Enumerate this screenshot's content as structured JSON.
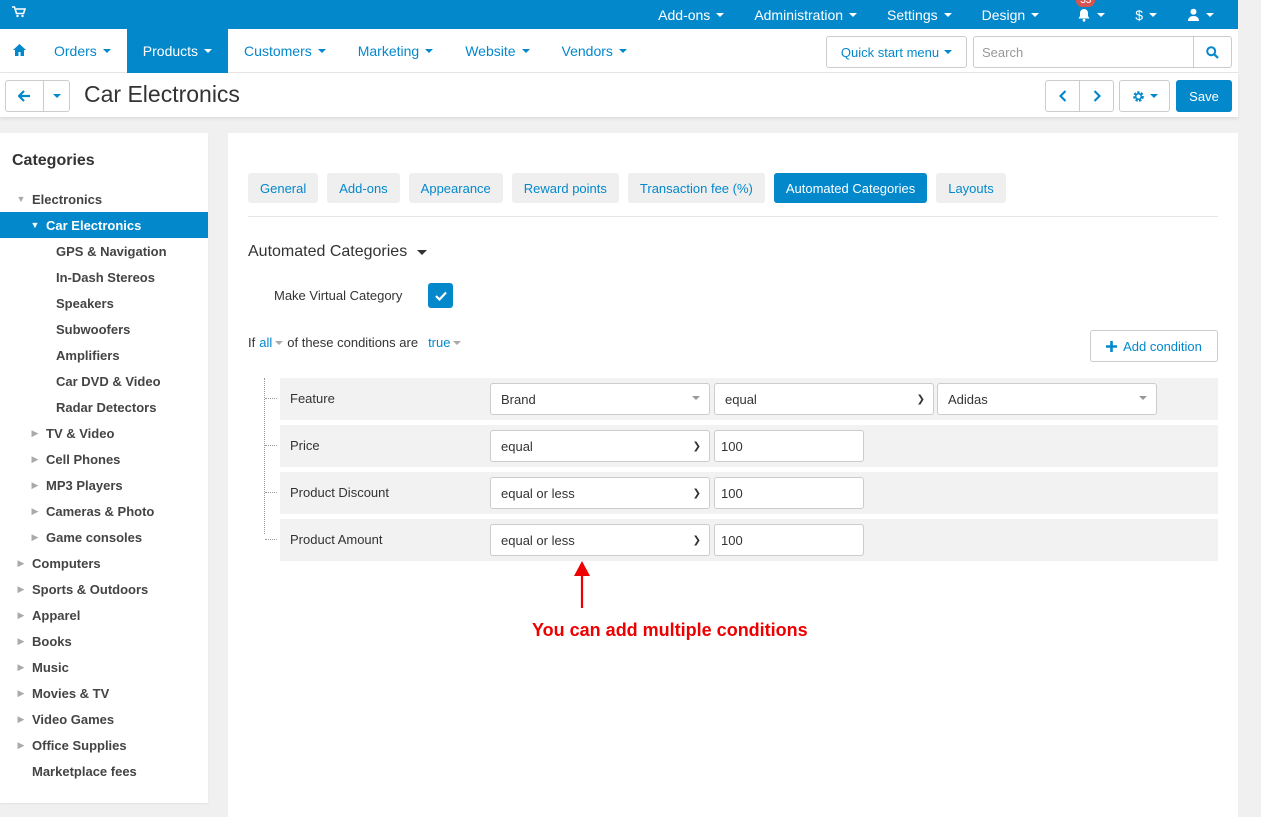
{
  "topbar": {
    "items": [
      {
        "label": "Add-ons"
      },
      {
        "label": "Administration"
      },
      {
        "label": "Settings"
      },
      {
        "label": "Design"
      }
    ],
    "notifications_count": "33",
    "currency": "$"
  },
  "mainnav": {
    "items": [
      {
        "label": "Orders"
      },
      {
        "label": "Products"
      },
      {
        "label": "Customers"
      },
      {
        "label": "Marketing"
      },
      {
        "label": "Website"
      },
      {
        "label": "Vendors"
      }
    ],
    "quick_start": "Quick start menu",
    "search_placeholder": "Search"
  },
  "titlebar": {
    "title": "Car Electronics",
    "save": "Save"
  },
  "sidebar": {
    "title": "Categories",
    "items": [
      {
        "label": "Electronics",
        "level": 0,
        "expanded": true
      },
      {
        "label": "Car Electronics",
        "level": 1,
        "expanded": true,
        "selected": true
      },
      {
        "label": "GPS & Navigation",
        "level": 2
      },
      {
        "label": "In-Dash Stereos",
        "level": 2
      },
      {
        "label": "Speakers",
        "level": 2
      },
      {
        "label": "Subwoofers",
        "level": 2
      },
      {
        "label": "Amplifiers",
        "level": 2
      },
      {
        "label": "Car DVD & Video",
        "level": 2
      },
      {
        "label": "Radar Detectors",
        "level": 2
      },
      {
        "label": "TV & Video",
        "level": 1,
        "collapsed": true
      },
      {
        "label": "Cell Phones",
        "level": 1,
        "collapsed": true
      },
      {
        "label": "MP3 Players",
        "level": 1,
        "collapsed": true
      },
      {
        "label": "Cameras & Photo",
        "level": 1,
        "collapsed": true
      },
      {
        "label": "Game consoles",
        "level": 1,
        "collapsed": true
      },
      {
        "label": "Computers",
        "level": 0,
        "collapsed": true
      },
      {
        "label": "Sports & Outdoors",
        "level": 0,
        "collapsed": true
      },
      {
        "label": "Apparel",
        "level": 0,
        "collapsed": true
      },
      {
        "label": "Books",
        "level": 0,
        "collapsed": true
      },
      {
        "label": "Music",
        "level": 0,
        "collapsed": true
      },
      {
        "label": "Movies & TV",
        "level": 0,
        "collapsed": true
      },
      {
        "label": "Video Games",
        "level": 0,
        "collapsed": true
      },
      {
        "label": "Office Supplies",
        "level": 0,
        "collapsed": true
      },
      {
        "label": "Marketplace fees",
        "level": 0
      }
    ]
  },
  "tabs": [
    {
      "label": "General"
    },
    {
      "label": "Add-ons"
    },
    {
      "label": "Appearance"
    },
    {
      "label": "Reward points"
    },
    {
      "label": "Transaction fee (%)"
    },
    {
      "label": "Automated Categories",
      "active": true
    },
    {
      "label": "Layouts"
    }
  ],
  "automated": {
    "title": "Automated Categories",
    "virtual_label": "Make Virtual Category",
    "if_text": "If",
    "all_text": "all",
    "of_these_text": "of these conditions are",
    "true_text": "true",
    "add_condition": "Add condition",
    "conditions": [
      {
        "label": "Feature",
        "operand": "Brand",
        "operator": "equal",
        "value": "Adidas"
      },
      {
        "label": "Price",
        "operator": "equal",
        "value": "100"
      },
      {
        "label": "Product Discount",
        "operator": "equal or less",
        "value": "100"
      },
      {
        "label": "Product Amount",
        "operator": "equal or less",
        "value": "100"
      }
    ]
  },
  "annotation": "You can add multiple conditions",
  "colors": {
    "accent": "#0388cc",
    "annotation": "#e00000"
  }
}
